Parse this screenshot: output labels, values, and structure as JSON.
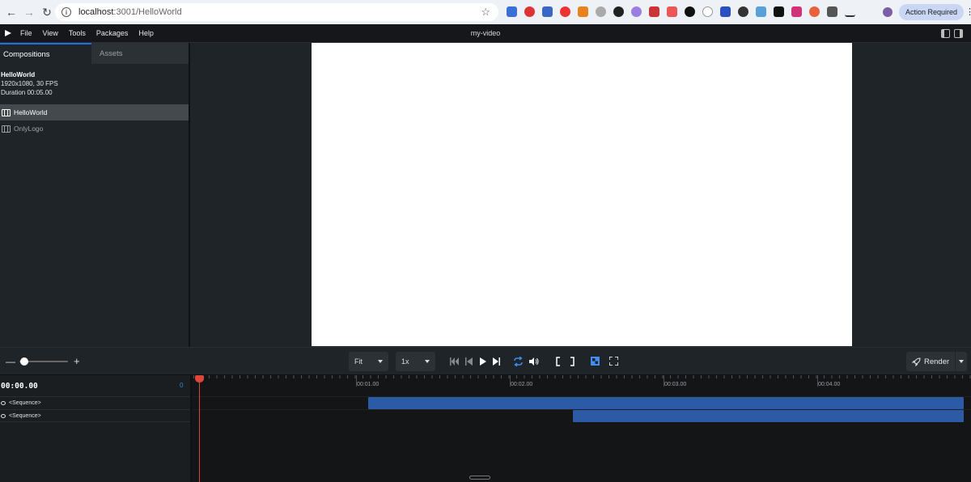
{
  "browser": {
    "url_host": "localhost",
    "url_path": ":3001/HelloWorld",
    "action_button": "Action Required"
  },
  "menubar": {
    "items": [
      "File",
      "View",
      "Tools",
      "Packages",
      "Help"
    ],
    "title": "my-video"
  },
  "sidebar": {
    "tabs": [
      {
        "label": "Compositions",
        "active": true
      },
      {
        "label": "Assets",
        "active": false
      }
    ],
    "composition_info": {
      "name": "HelloWorld",
      "resolution": "1920x1080, 30 FPS",
      "duration": "Duration 00:05.00"
    },
    "compositions": [
      {
        "label": "HelloWorld",
        "selected": true
      },
      {
        "label": "OnlyLogo",
        "selected": false
      }
    ]
  },
  "controls": {
    "zoom_slider_level": 0.05,
    "size_select": "Fit",
    "speed_select": "1x",
    "render_label": "Render"
  },
  "timeline": {
    "timecode": "00:00.00",
    "frame": "0",
    "ruler_labels": [
      "00:01.00",
      "00:02.00",
      "00:03.00",
      "00:04.00"
    ],
    "tracks": [
      {
        "label": "<Sequence>",
        "start_seconds": 1.1,
        "end_seconds": 5.0
      },
      {
        "label": "<Sequence>",
        "start_seconds": 2.43,
        "end_seconds": 5.0
      }
    ],
    "playhead_seconds": 0,
    "duration_seconds": 5
  },
  "colors": {
    "accent": "#1f6fe0",
    "playhead": "#e0453a",
    "sequence": "#2d5aa6"
  }
}
